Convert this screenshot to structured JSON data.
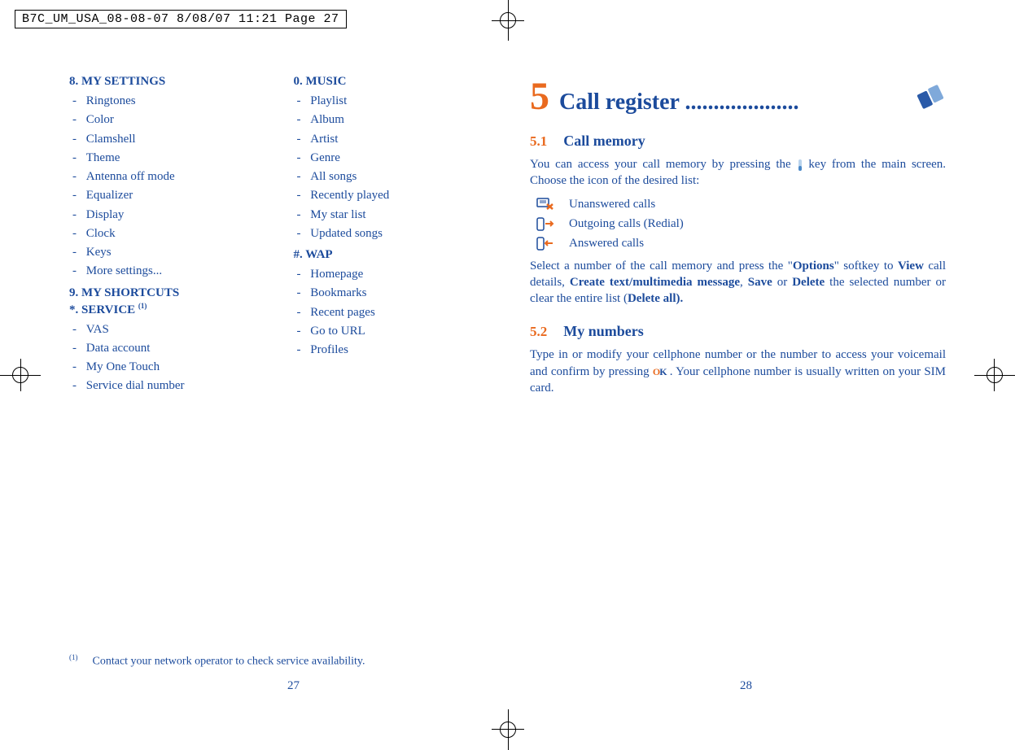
{
  "print_header": "B7C_UM_USA_08-08-07  8/08/07  11:21  Page 27",
  "left": {
    "col1": {
      "sections": [
        {
          "title": "8. MY SETTINGS",
          "items": [
            "Ringtones",
            "Color",
            "Clamshell",
            "Theme",
            "Antenna off mode",
            "Equalizer",
            "Display",
            "Clock",
            "Keys",
            "More settings..."
          ]
        },
        {
          "title": "9. MY SHORTCUTS",
          "items": []
        },
        {
          "title": "*. SERVICE ",
          "sup": "(1)",
          "items": [
            "VAS",
            "Data account",
            "My One Touch",
            "Service dial number"
          ]
        }
      ]
    },
    "col2": {
      "sections": [
        {
          "title": "0. MUSIC",
          "items": [
            "Playlist",
            "Album",
            "Artist",
            "Genre",
            "All songs",
            "Recently played",
            "My star list",
            "Updated songs"
          ]
        },
        {
          "title": "#. WAP",
          "items": [
            "Homepage",
            "Bookmarks",
            "Recent pages",
            "Go to URL",
            "Profiles"
          ]
        }
      ]
    },
    "footnote_sup": "(1)",
    "footnote": "Contact your network operator to check service availability.",
    "page_num": "27"
  },
  "right": {
    "chapter_num": "5",
    "chapter_title": "Call register ....................",
    "s51_num": "5.1",
    "s51_title": "Call memory",
    "s51_p1a": "You can access your call memory by pressing the ",
    "s51_p1b": " key from the main screen. Choose the icon of the desired list:",
    "calls": [
      {
        "label": "Unanswered calls"
      },
      {
        "label": "Outgoing calls (Redial)"
      },
      {
        "label": "Answered calls"
      }
    ],
    "s51_p2a": "Select a number of the call memory and press the \"",
    "s51_opt": "Options",
    "s51_p2b": "\" softkey to ",
    "s51_view": "View",
    "s51_p2c": " call details, ",
    "s51_create": "Create text/multimedia message",
    "s51_p2d": ", ",
    "s51_save": "Save",
    "s51_p2e": " or ",
    "s51_delete": "Delete",
    "s51_p2f": " the selected number or clear the entire list (",
    "s51_deleteall": "Delete all).",
    "s52_num": "5.2",
    "s52_title": "My numbers",
    "s52_p1a": "Type in or modify your cellphone number or the number to access your voicemail and confirm by pressing ",
    "s52_ok": "OK",
    "s52_p1b": ". Your cellphone number is usually written on your SIM card.",
    "page_num": "28"
  }
}
